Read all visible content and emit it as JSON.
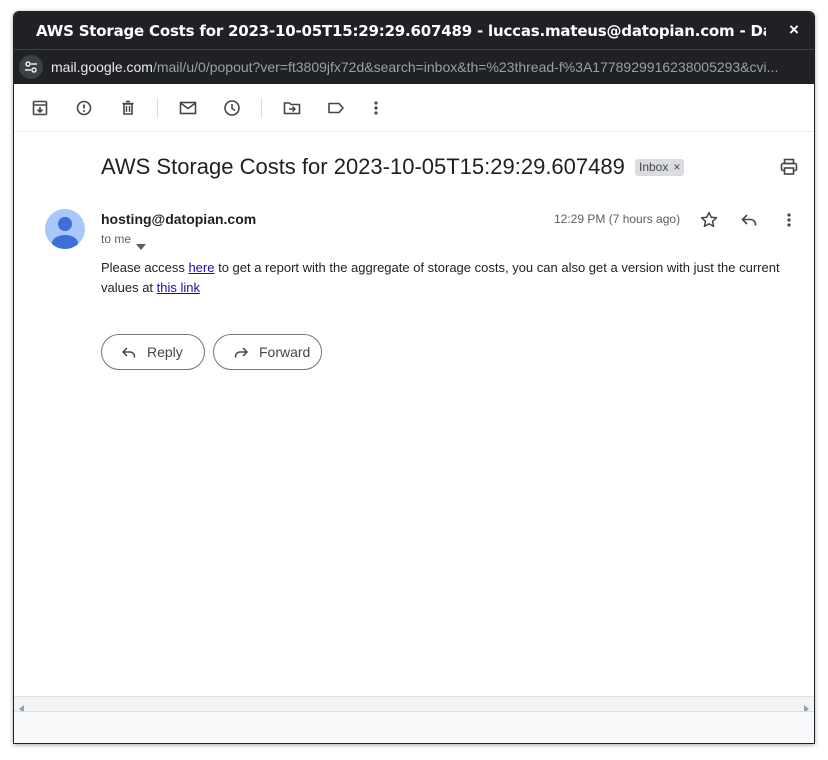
{
  "window": {
    "title": "AWS Storage Costs for 2023-10-05T15:29:29.607489 - luccas.mateus@datopian.com - Datopian Mail - G...",
    "close_glyph": "×"
  },
  "urlbar": {
    "host": "mail.google.com",
    "path": "/mail/u/0/popout?ver=ft3809jfx72d&search=inbox&th=%23thread-f%3A1778929916238005293&cvi..."
  },
  "toolbar": {
    "icons": [
      "archive-icon",
      "report-spam-icon",
      "delete-icon",
      "mark-unread-icon",
      "snooze-icon",
      "move-to-icon",
      "label-icon",
      "more-vert-icon"
    ]
  },
  "email": {
    "subject": "AWS Storage Costs for 2023-10-05T15:29:29.607489",
    "label_chip": "Inbox",
    "label_chip_remove": "×",
    "sender": "hosting@datopian.com",
    "recipient_summary": "to me",
    "timestamp": "12:29 PM (7 hours ago)",
    "body": {
      "part1": "Please access ",
      "link1": "here",
      "part2": " to get a report with the aggregate of storage costs, you can also get a version with just the current values at ",
      "link2": "this link"
    }
  },
  "actions": {
    "reply_label": "Reply",
    "forward_label": "Forward"
  },
  "colors": {
    "titlebar_bg": "#202124",
    "avatar_bg": "#a8c7fa",
    "avatar_fg": "#3d6fd6",
    "link": "#1a0dab",
    "chip_bg": "#dadce0"
  }
}
